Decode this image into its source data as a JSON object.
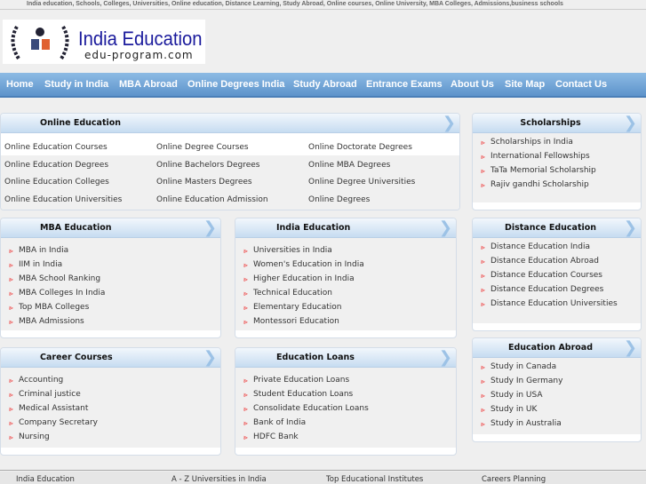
{
  "keywords": "India education, Schools, Colleges, Universities, Online education, Distance Learning, Study Abroad, Online courses, Online University, MBA Colleges, Admissions,business schools",
  "logo": {
    "title": "India Education",
    "subtitle": "edu-program.com"
  },
  "nav": [
    "Home",
    "Study in India",
    "MBA Abroad",
    "Online Degrees India",
    "Study Abroad",
    "Entrance Exams",
    "About Us",
    "Site Map",
    "Contact Us"
  ],
  "online": {
    "title": "Online Education",
    "items": [
      "Online Education Courses",
      "Online Degree Courses",
      "Online Doctorate Degrees",
      "Online Education Degrees",
      "Online Bachelors Degrees",
      "Online MBA Degrees",
      "Online Education Colleges",
      "Online Masters Degrees",
      "Online Degree Universities",
      "Online Education Universities",
      "Online Education Admission",
      "Online Degrees"
    ]
  },
  "scholarships": {
    "title": "Scholarships",
    "items": [
      "Scholarships in India",
      "International Fellowships",
      "TaTa Memorial Scholarship",
      "Rajiv gandhi Scholarship"
    ]
  },
  "mba": {
    "title": "MBA Education",
    "items": [
      "MBA in India",
      "IIM in India",
      "MBA School Ranking",
      "MBA Colleges In India",
      "Top MBA Colleges",
      "MBA Admissions"
    ]
  },
  "india": {
    "title": "India Education",
    "items": [
      "Universities in India",
      "Women's Education in India",
      "Higher Education in India",
      "Technical Education",
      "Elementary Education",
      "Montessori Education"
    ]
  },
  "distance": {
    "title": "Distance Education",
    "items": [
      "Distance Education India",
      "Distance Education Abroad",
      "Distance Education Courses",
      "Distance Education Degrees",
      "Distance Education Universities"
    ]
  },
  "career": {
    "title": "Career Courses",
    "items": [
      "Accounting",
      "Criminal justice",
      "Medical Assistant",
      "Company Secretary",
      "Nursing"
    ]
  },
  "loans": {
    "title": "Education Loans",
    "items": [
      "Private Education Loans",
      "Student Education Loans",
      "Consolidate Education Loans",
      "Bank of India",
      "HDFC Bank"
    ]
  },
  "abroad": {
    "title": "Education Abroad",
    "items": [
      "Study in Canada",
      "Study In Germany",
      "Study in USA",
      "Study in UK",
      "Study in Australia"
    ]
  },
  "footer": [
    "India Education",
    "A - Z Universities in India",
    "Top Educational Institutes",
    "Careers Planning"
  ]
}
